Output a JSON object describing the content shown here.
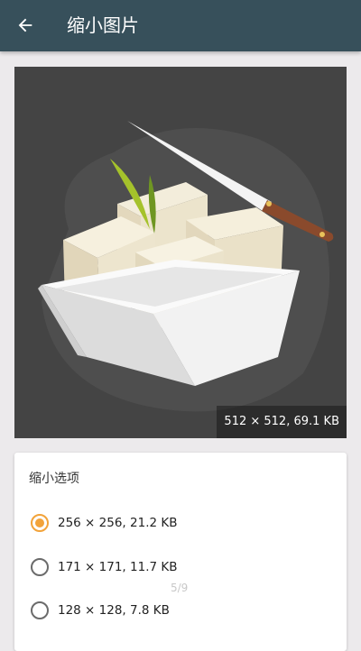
{
  "appbar": {
    "title": "缩小图片",
    "back_icon": "arrow-back-icon"
  },
  "preview": {
    "image": "tofu-bowl-knife-illustration",
    "size_label": "512 × 512,  69.1 KB"
  },
  "options": {
    "title": "缩小选项",
    "items": [
      {
        "label": "256 × 256,  21.2 KB",
        "selected": true
      },
      {
        "label": "171 × 171,  11.7 KB",
        "selected": false
      },
      {
        "label": "128 × 128,  7.8 KB",
        "selected": false
      }
    ]
  },
  "page_indicator": "5/9",
  "colors": {
    "appbar": "#37505b",
    "accent": "#f2a33a",
    "preview_bg": "#444444"
  }
}
